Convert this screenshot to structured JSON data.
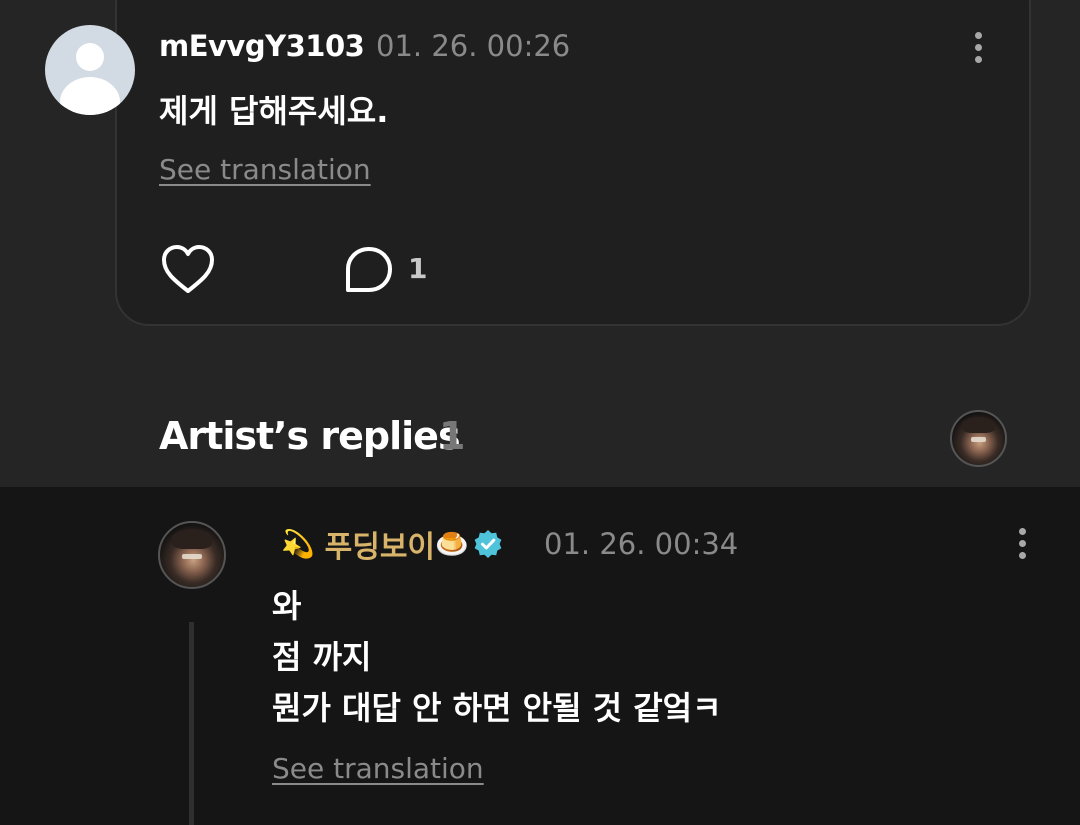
{
  "comment": {
    "username": "mEvvgY3103",
    "timestamp": "01. 26. 00:26",
    "text": "제게 답해주세요.",
    "see_translation": "See translation",
    "like_icon": "heart-outline-icon",
    "reply_icon": "speech-bubble-icon",
    "reply_count": "1"
  },
  "artist_replies": {
    "title": "Artist’s replies",
    "count": "1"
  },
  "reply": {
    "emoji_prefix": "💫",
    "artist_name": "푸딩보이",
    "emoji_suffix": "🍮",
    "verified_icon": "verified-badge-icon",
    "timestamp": "01. 26. 00:34",
    "lines": [
      "와",
      "점 까지",
      "뭔가 대답 안 하면 안될 것 같엌ㅋ"
    ],
    "see_translation": "See translation"
  },
  "colors": {
    "background": "#252525",
    "reply_background": "#151515",
    "card_background": "#1f1f1f",
    "artist_name": "#d7b46a",
    "verified_badge": "#4fc3d9",
    "muted_text": "#8a8a8a"
  }
}
